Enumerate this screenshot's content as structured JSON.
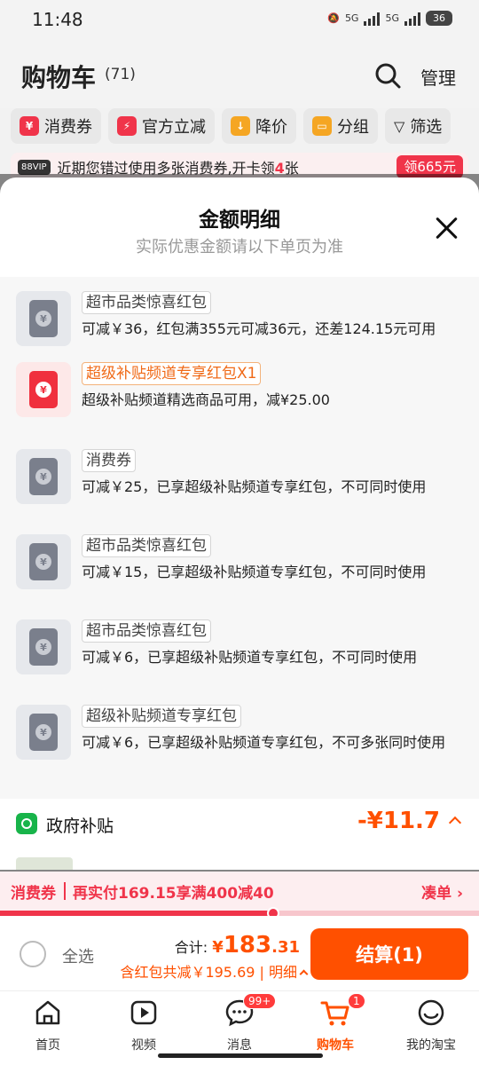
{
  "status": {
    "time": "11:48",
    "network1": "5G",
    "network2": "5G",
    "battery": "36"
  },
  "header": {
    "title": "购物车",
    "count": "(71)",
    "manage": "管理"
  },
  "chips": [
    {
      "label": "消费券",
      "icon": "coupon-icon",
      "color": "#f0344a",
      "glyph": "¥"
    },
    {
      "label": "官方立减",
      "icon": "lightning-icon",
      "color": "#f0344a",
      "glyph": "⚡"
    },
    {
      "label": "降价",
      "icon": "down-arrow-icon",
      "color": "#f5a623",
      "glyph": "↓"
    },
    {
      "label": "分组",
      "icon": "folder-icon",
      "color": "#f5a623",
      "glyph": "▭"
    },
    {
      "label": "筛选",
      "icon": "filter-icon",
      "color": "",
      "glyph": "▽"
    }
  ],
  "vip": {
    "tag": "88VIP",
    "text_before": "近期您错过使用多张消费券,开卡领",
    "highlight": "4",
    "text_after": "张",
    "button": "领665元"
  },
  "sheet": {
    "title": "金额明细",
    "subtitle": "实际优惠金额请以下单页为准",
    "coupons": [
      {
        "tag": "超市品类惊喜红包",
        "desc": "可减￥36，红包满355元可减36元，还差124.15元可用",
        "style": "grey"
      },
      {
        "tag": "超级补贴频道专享红包X1",
        "desc": "超级补贴频道精选商品可用，减¥25.00",
        "style": "red"
      },
      {
        "tag": "消费券",
        "desc": "可减￥25，已享超级补贴频道专享红包，不可同时使用",
        "style": "grey"
      },
      {
        "tag": "超市品类惊喜红包",
        "desc": "可减￥15，已享超级补贴频道专享红包，不可同时使用",
        "style": "grey"
      },
      {
        "tag": "超市品类惊喜红包",
        "desc": "可减￥6，已享超级补贴频道专享红包，不可同时使用",
        "style": "grey"
      },
      {
        "tag": "超级补贴频道专享红包",
        "desc": "可减￥6，已享超级补贴频道专享红包，不可多张同时使用",
        "style": "grey"
      }
    ],
    "gov": {
      "label": "政府补贴",
      "amount": "-¥11.7"
    }
  },
  "promo": {
    "tag": "消费券",
    "text": "再实付169.15享满400减40",
    "link": "凑单 ›",
    "progress": 0.57
  },
  "checkout": {
    "select_all": "全选",
    "total_label": "合计:",
    "currency": "¥",
    "total_int": "183",
    "total_dec": ".31",
    "discount": "含红包共减￥195.69 | 明细",
    "pay": "结算(1)"
  },
  "tabs": [
    {
      "label": "首页",
      "icon": "home-icon",
      "badge": ""
    },
    {
      "label": "视频",
      "icon": "video-icon",
      "badge": ""
    },
    {
      "label": "消息",
      "icon": "message-icon",
      "badge": "99+"
    },
    {
      "label": "购物车",
      "icon": "cart-icon",
      "badge": "1"
    },
    {
      "label": "我的淘宝",
      "icon": "profile-icon",
      "badge": ""
    }
  ]
}
